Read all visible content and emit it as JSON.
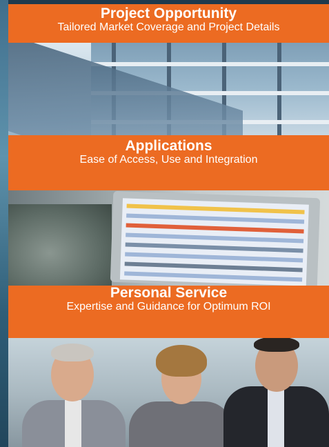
{
  "sections": [
    {
      "title": "Project Opportunity",
      "subtitle": "Tailored Market Coverage and Project Details"
    },
    {
      "title": "Applications",
      "subtitle": "Ease of Access, Use and Integration"
    },
    {
      "title": "Personal Service",
      "subtitle": "Expertise and Guidance for Optimum ROI"
    }
  ],
  "colors": {
    "band": "#ec6b22",
    "band_text": "#ffffff",
    "edge": "#3f6e8c"
  },
  "images": [
    {
      "name": "office-building-photo"
    },
    {
      "name": "computer-monitor-photo"
    },
    {
      "name": "business-team-photo"
    }
  ]
}
